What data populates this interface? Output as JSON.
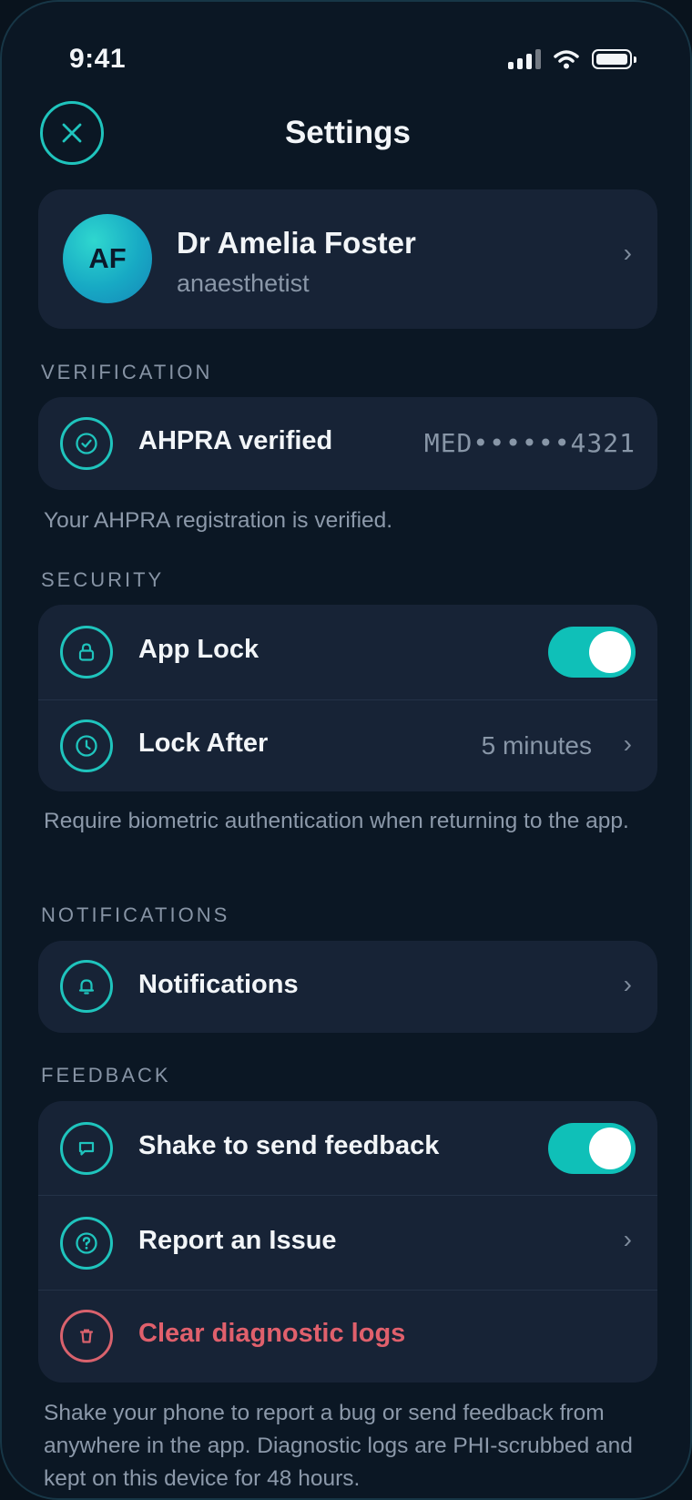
{
  "status_bar": {
    "time": "9:41"
  },
  "header": {
    "title": "Settings",
    "close_icon": "close-icon"
  },
  "profile": {
    "initials": "AF",
    "name": "Dr Amelia Foster",
    "role": "anaesthetist"
  },
  "verification": {
    "section_label": "VERIFICATION",
    "label": "AHPRA verified",
    "registration": "MED••••••4321",
    "note": "Your AHPRA registration is verified."
  },
  "security": {
    "section_label": "SECURITY",
    "app_lock": {
      "label": "App Lock",
      "enabled": true
    },
    "lock_after": {
      "label": "Lock After",
      "value": "5 minutes"
    },
    "note": "Require biometric authentication when returning to the app."
  },
  "notifications": {
    "section_label": "NOTIFICATIONS",
    "label": "Notifications"
  },
  "feedback": {
    "section_label": "FEEDBACK",
    "shake": {
      "label": "Shake to send feedback",
      "enabled": true
    },
    "report": {
      "label": "Report an Issue"
    },
    "clear_logs": {
      "label": "Clear diagnostic logs"
    },
    "note": "Shake your phone to report a bug or send feedback from anywhere in the app. Diagnostic logs are PHI-scrubbed and kept on this device for 48 hours."
  },
  "colors": {
    "accent": "#1fc4bd",
    "danger": "#e0606c",
    "background": "#0b1724",
    "card": "#172336"
  }
}
